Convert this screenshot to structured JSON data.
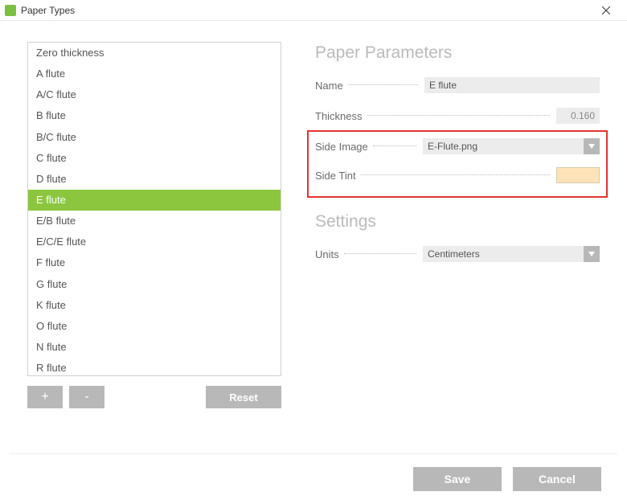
{
  "window": {
    "title": "Paper Types",
    "app_icon_glyph": "◧"
  },
  "list": {
    "items": [
      "Zero thickness",
      "A flute",
      "A/C flute",
      "B flute",
      "B/C flute",
      "C flute",
      "D flute",
      "E flute",
      "E/B flute",
      "E/C/E flute",
      "F flute",
      "G flute",
      "K flute",
      "O flute",
      "N flute",
      "R flute"
    ],
    "selected_index": 7,
    "buttons": {
      "add": "+",
      "remove": "-",
      "reset": "Reset"
    }
  },
  "params": {
    "section_title": "Paper Parameters",
    "name_label": "Name",
    "name_value": "E flute",
    "thickness_label": "Thickness",
    "thickness_value": "0.160",
    "side_image_label": "Side Image",
    "side_image_value": "E-Flute.png",
    "side_tint_label": "Side Tint",
    "side_tint_color": "#ffe3b8"
  },
  "settings": {
    "section_title": "Settings",
    "units_label": "Units",
    "units_value": "Centimeters"
  },
  "footer": {
    "save": "Save",
    "cancel": "Cancel"
  }
}
